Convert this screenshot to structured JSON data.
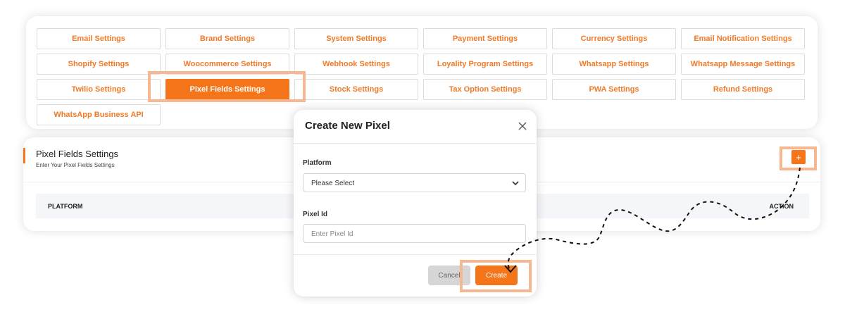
{
  "settings_tabs": [
    "Email Settings",
    "Brand Settings",
    "System Settings",
    "Payment Settings",
    "Currency Settings",
    "Email Notification Settings",
    "Shopify Settings",
    "Woocommerce Settings",
    "Webhook Settings",
    "Loyality Program Settings",
    "Whatsapp Settings",
    "Whatsapp Message Settings",
    "Twilio Settings",
    "Pixel Fields Settings",
    "Stock Settings",
    "Tax Option Settings",
    "PWA Settings",
    "Refund Settings",
    "WhatsApp Business API"
  ],
  "active_tab": "Pixel Fields Settings",
  "section": {
    "title": "Pixel Fields Settings",
    "subtitle": "Enter Your Pixel Fields Settings",
    "add_label": "+"
  },
  "table": {
    "columns": [
      "PLATFORM",
      "ACTION"
    ]
  },
  "modal": {
    "title": "Create New Pixel",
    "platform_label": "Platform",
    "platform_value": "Please Select",
    "pixel_id_label": "Pixel Id",
    "pixel_id_placeholder": "Enter Pixel Id",
    "cancel_label": "Cancel",
    "create_label": "Create"
  },
  "colors": {
    "accent": "#f5761a",
    "highlight": "#f7b891"
  },
  "icons": {
    "close": "close-icon",
    "dropdown": "chevron-down-icon"
  }
}
